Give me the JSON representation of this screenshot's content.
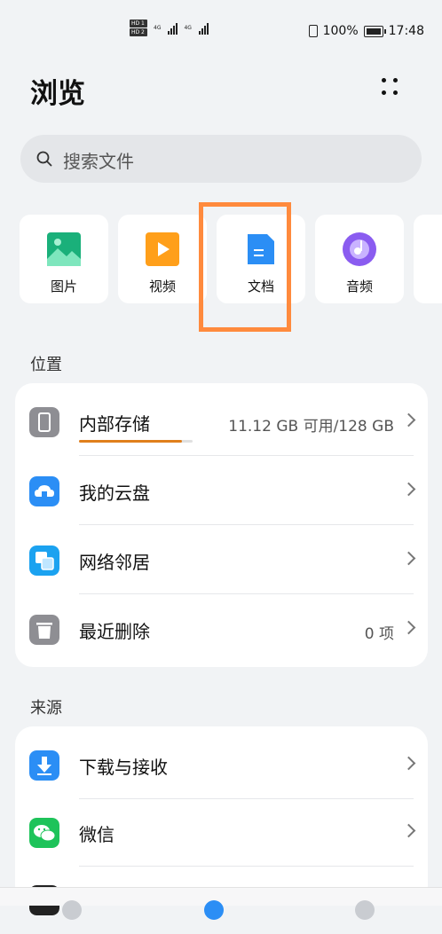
{
  "status_bar": {
    "hd1": "HD 1",
    "hd2": "HD 2",
    "net1": "4G",
    "net2": "4G",
    "battery": "100%",
    "time": "17:48"
  },
  "header": {
    "title": "浏览"
  },
  "search": {
    "placeholder": "搜索文件"
  },
  "categories": [
    {
      "label": "图片",
      "icon": "image-icon",
      "color": "#1ab07a"
    },
    {
      "label": "视频",
      "icon": "video-icon",
      "color": "#ff9f1a"
    },
    {
      "label": "文档",
      "icon": "document-icon",
      "color": "#2b8ef5"
    },
    {
      "label": "音频",
      "icon": "audio-icon",
      "color": "#8a5cf0"
    }
  ],
  "locations": {
    "header": "位置",
    "items": [
      {
        "label": "内部存储",
        "value": "11.12 GB 可用/128 GB",
        "icon": "phone-icon",
        "color": "#8e8e93",
        "used_fraction": 0.91
      },
      {
        "label": "我的云盘",
        "value": "",
        "icon": "cloud-icon",
        "color": "#2b8ef5"
      },
      {
        "label": "网络邻居",
        "value": "",
        "icon": "network-icon",
        "color": "#1ba2f0"
      },
      {
        "label": "最近删除",
        "value": "0 项",
        "icon": "trash-icon",
        "color": "#8e8e93"
      }
    ]
  },
  "sources": {
    "header": "来源",
    "items": [
      {
        "label": "下载与接收",
        "icon": "download-icon",
        "color": "#2b8ef5"
      },
      {
        "label": "微信",
        "icon": "wechat-icon",
        "color": "#1ec35a"
      }
    ]
  },
  "highlight_color": "#ff8a3d"
}
